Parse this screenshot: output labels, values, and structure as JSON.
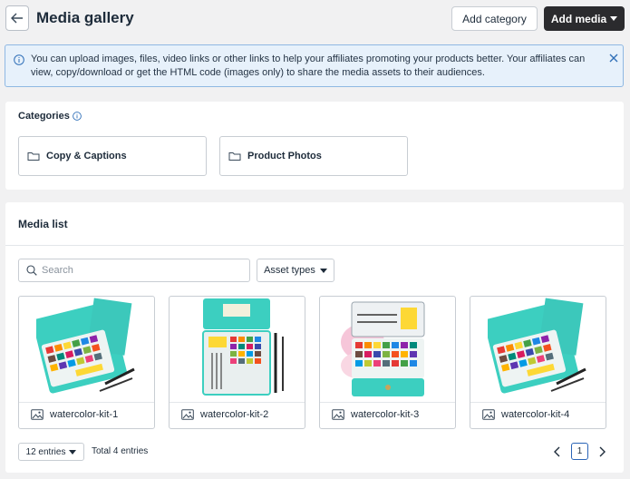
{
  "header": {
    "title": "Media gallery",
    "add_category_label": "Add category",
    "add_media_label": "Add media"
  },
  "info": {
    "text": "You can upload images, files, video links or other links to help your affiliates promoting your products better. Your affiliates can view, copy/download or get the HTML code (images only) to share the media assets to their audiences."
  },
  "categories": {
    "title": "Categories",
    "items": [
      {
        "label": "Copy & Captions"
      },
      {
        "label": "Product Photos"
      }
    ]
  },
  "media": {
    "title": "Media list",
    "search_placeholder": "Search",
    "asset_types_label": "Asset types",
    "items": [
      {
        "name": "watercolor-kit-1"
      },
      {
        "name": "watercolor-kit-2"
      },
      {
        "name": "watercolor-kit-3"
      },
      {
        "name": "watercolor-kit-4"
      }
    ],
    "entries_label": "12 entries",
    "total_label": "Total 4 entries",
    "current_page": "1"
  },
  "colors": {
    "accent": "#2b2b2e",
    "info_bg": "#e7f1fb",
    "info_border": "#8fb8e3",
    "page_active": "#2a64b7",
    "teal": "#3ccfc0"
  }
}
